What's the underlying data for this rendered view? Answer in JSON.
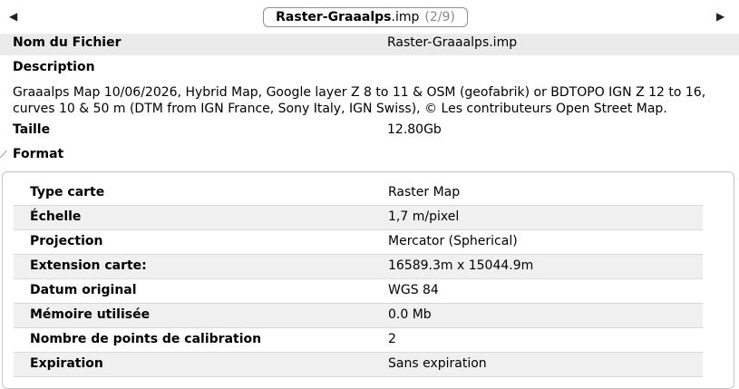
{
  "nav": {
    "prev_icon": "triangle-left-icon",
    "next_icon": "triangle-right-icon",
    "file_base": "Raster-Graaalps",
    "file_ext": ".imp",
    "counter": "(2/9)"
  },
  "info": {
    "filename_label": "Nom du Fichier",
    "filename_value": "Raster-Graaalps.imp",
    "description_label": "Description",
    "description_text": "Graaalps Map 10/06/2026, Hybrid Map, Google layer Z 8 to 11 & OSM (geofabrik) or BDTOPO IGN Z 12 to 16, curves 10 & 50 m (DTM from IGN France, Sony Italy, IGN Swiss), © Les contributeurs Open Street Map.",
    "size_label": "Taille",
    "size_value": "12.80Gb",
    "format_label": "Format"
  },
  "format_rows": [
    {
      "label": "Type carte",
      "value": "Raster Map"
    },
    {
      "label": "Échelle",
      "value": "1,7 m/pixel"
    },
    {
      "label": "Projection",
      "value": "Mercator (Spherical)"
    },
    {
      "label": "Extension carte:",
      "value": "16589.3m x 15044.9m"
    },
    {
      "label": "Datum original",
      "value": "WGS 84"
    },
    {
      "label": "Mémoire utilisée",
      "value": "0.0 Mb"
    },
    {
      "label": "Nombre de points de calibration",
      "value": "2"
    },
    {
      "label": "Expiration",
      "value": "Sans expiration"
    }
  ]
}
